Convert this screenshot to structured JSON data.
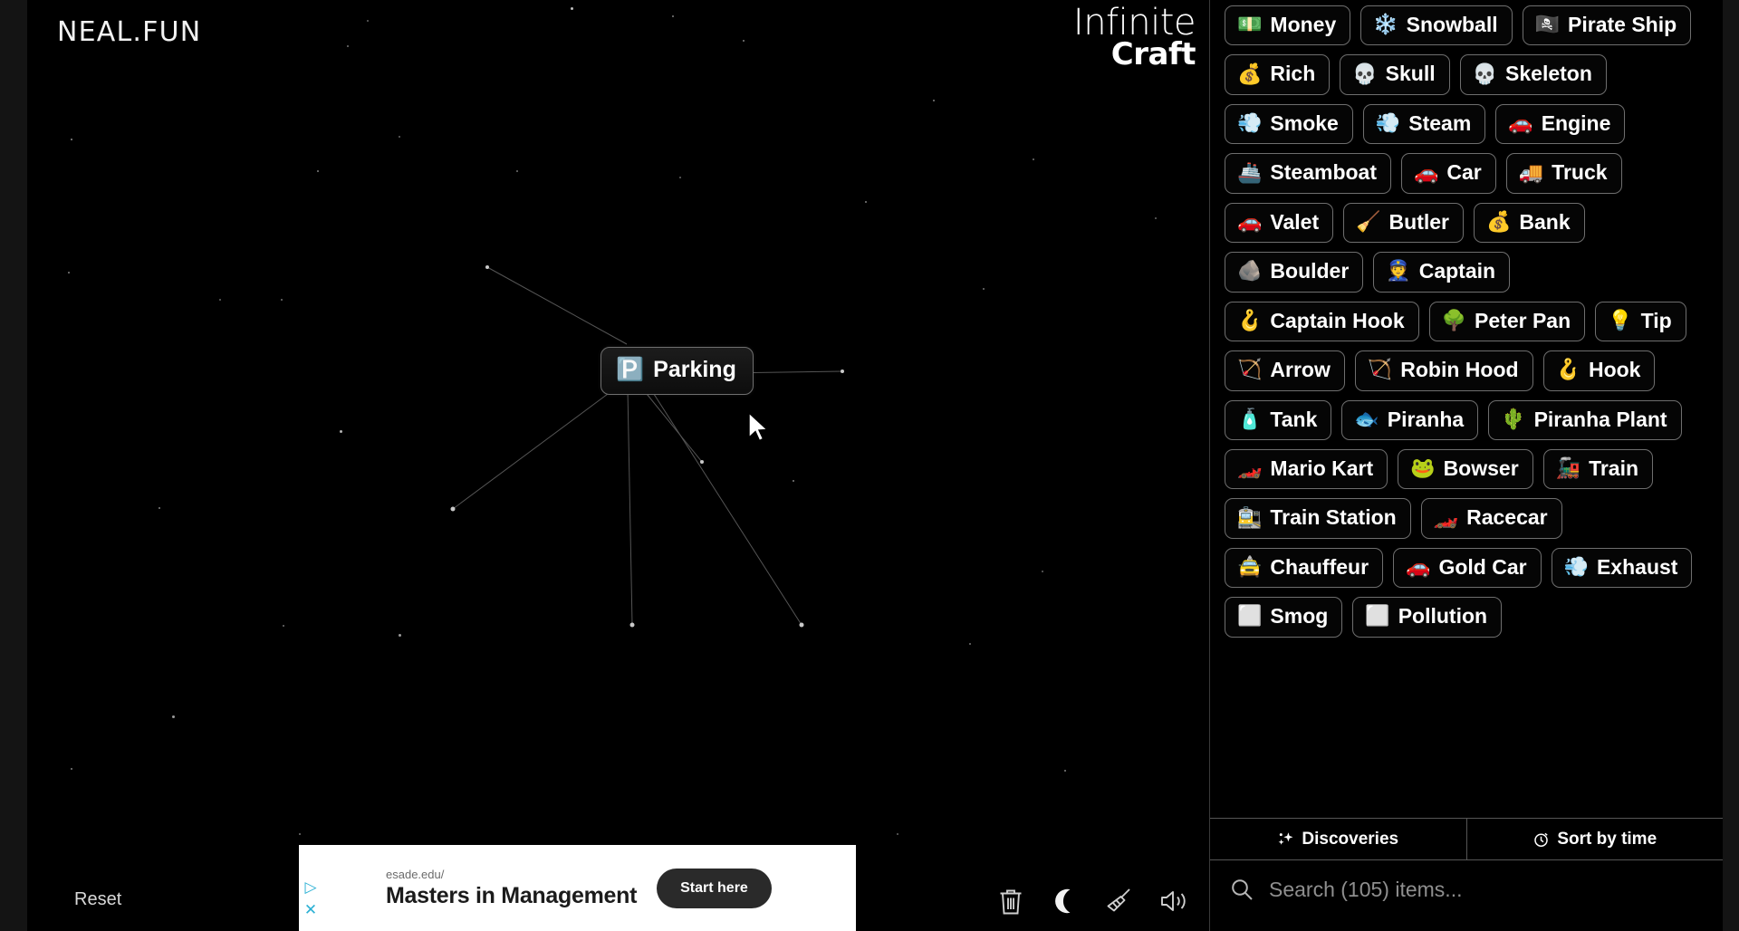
{
  "brand": {
    "site_logo": "NEAL.FUN",
    "title_line1": "Infinite",
    "title_line2": "Craft"
  },
  "canvas": {
    "reset_label": "Reset",
    "node": {
      "emoji": "🅿️",
      "label": "Parking",
      "icon_name": "parking-emoji"
    }
  },
  "toolbar": {
    "icons": [
      {
        "name": "trash-icon",
        "label": "Delete"
      },
      {
        "name": "moon-icon",
        "label": "Dark mode"
      },
      {
        "name": "broom-icon",
        "label": "Clear board"
      },
      {
        "name": "speaker-icon",
        "label": "Sound"
      }
    ]
  },
  "ad": {
    "url": "esade.edu/",
    "headline": "Masters in Management",
    "cta": "Start here",
    "info_glyph": "▷",
    "close_glyph": "✕"
  },
  "sidebar": {
    "items": [
      {
        "emoji": "💵",
        "label": "Money"
      },
      {
        "emoji": "❄️",
        "label": "Snowball"
      },
      {
        "emoji": "🏴‍☠️",
        "label": "Pirate Ship"
      },
      {
        "emoji": "💰",
        "label": "Rich"
      },
      {
        "emoji": "💀",
        "label": "Skull"
      },
      {
        "emoji": "💀",
        "label": "Skeleton"
      },
      {
        "emoji": "💨",
        "label": "Smoke"
      },
      {
        "emoji": "💨",
        "label": "Steam"
      },
      {
        "emoji": "🚗",
        "label": "Engine"
      },
      {
        "emoji": "🚢",
        "label": "Steamboat"
      },
      {
        "emoji": "🚗",
        "label": "Car"
      },
      {
        "emoji": "🚚",
        "label": "Truck"
      },
      {
        "emoji": "🚗",
        "label": "Valet"
      },
      {
        "emoji": "🧹",
        "label": "Butler"
      },
      {
        "emoji": "💰",
        "label": "Bank"
      },
      {
        "emoji": "🪨",
        "label": "Boulder"
      },
      {
        "emoji": "👮",
        "label": "Captain"
      },
      {
        "emoji": "🪝",
        "label": "Captain Hook"
      },
      {
        "emoji": "🌳",
        "label": "Peter Pan"
      },
      {
        "emoji": "💡",
        "label": "Tip"
      },
      {
        "emoji": "🏹",
        "label": "Arrow"
      },
      {
        "emoji": "🏹",
        "label": "Robin Hood"
      },
      {
        "emoji": "🪝",
        "label": "Hook"
      },
      {
        "emoji": "🧴",
        "label": "Tank"
      },
      {
        "emoji": "🐟",
        "label": "Piranha"
      },
      {
        "emoji": "🌵",
        "label": "Piranha Plant"
      },
      {
        "emoji": "🏎️",
        "label": "Mario Kart"
      },
      {
        "emoji": "🐸",
        "label": "Bowser"
      },
      {
        "emoji": "🚂",
        "label": "Train"
      },
      {
        "emoji": "🚉",
        "label": "Train Station"
      },
      {
        "emoji": "🏎️",
        "label": "Racecar"
      },
      {
        "emoji": "🚖",
        "label": "Chauffeur"
      },
      {
        "emoji": "🚗",
        "label": "Gold Car"
      },
      {
        "emoji": "💨",
        "label": "Exhaust"
      },
      {
        "emoji": "⬜",
        "label": "Smog"
      },
      {
        "emoji": "⬜",
        "label": "Pollution"
      }
    ],
    "tabs": [
      {
        "name": "discoveries",
        "label": "Discoveries",
        "icon": "sparkles-icon"
      },
      {
        "name": "sort-by-time",
        "label": "Sort by time",
        "icon": "stopwatch-icon"
      }
    ],
    "search": {
      "placeholder": "Search (105) items...",
      "value": "",
      "item_count": 105
    }
  }
}
